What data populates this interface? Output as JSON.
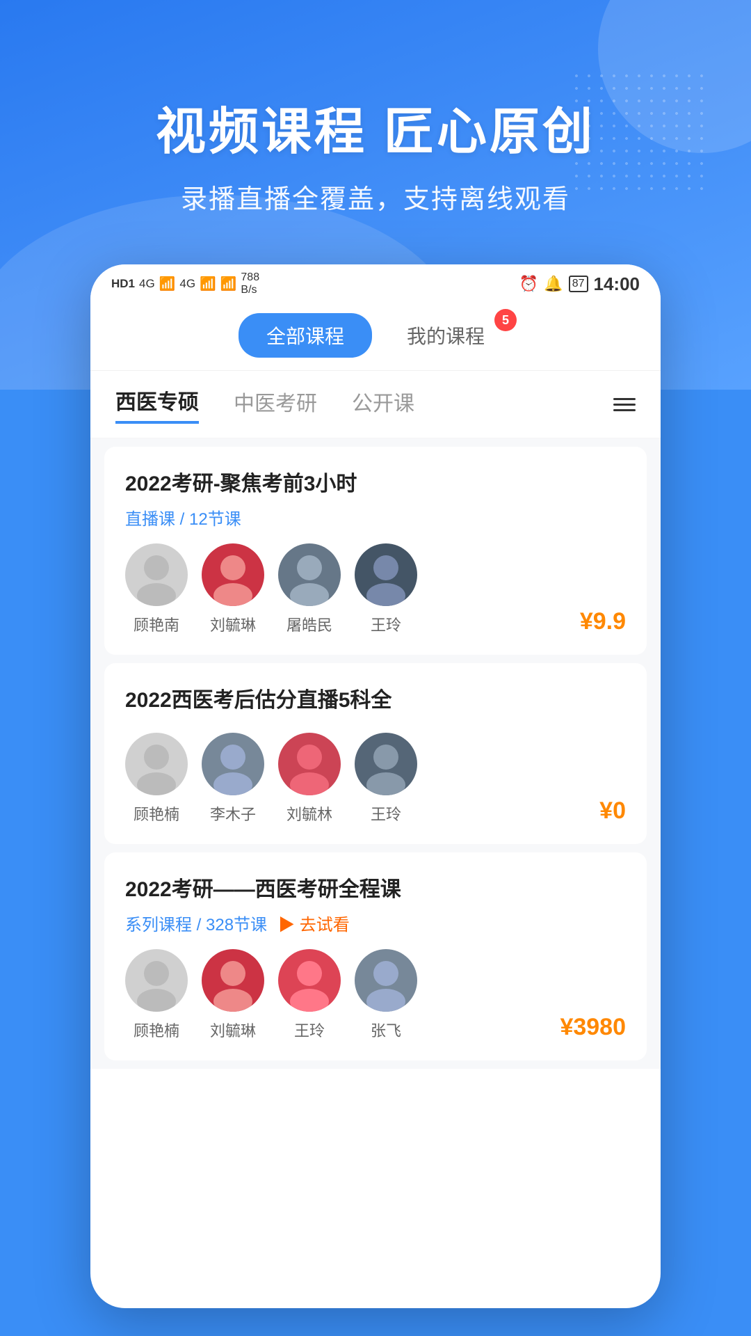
{
  "hero": {
    "title": "视频课程 匠心原创",
    "subtitle": "录播直播全覆盖，支持离线观看"
  },
  "status_bar": {
    "left": "HD1 4G 4G 788 B/s",
    "right": "14:00",
    "battery": "87"
  },
  "tabs": {
    "all_courses": "全部课程",
    "my_courses": "我的课程",
    "badge": "5"
  },
  "categories": [
    {
      "id": "western",
      "label": "西医专硕",
      "active": true
    },
    {
      "id": "tcm",
      "label": "中医考研",
      "active": false
    },
    {
      "id": "open",
      "label": "公开课",
      "active": false
    }
  ],
  "courses": [
    {
      "id": 1,
      "title": "2022考研-聚焦考前3小时",
      "meta_type": "直播课",
      "meta_lessons": "12节课",
      "teachers": [
        {
          "name": "顾艳南",
          "avatar_color": "#c8c8c8"
        },
        {
          "name": "刘毓琳",
          "avatar_color": "#bb3344"
        },
        {
          "name": "屠皓民",
          "avatar_color": "#667788"
        },
        {
          "name": "王玲",
          "avatar_color": "#445566"
        }
      ],
      "price": "¥9.9",
      "price_color": "#ff8800",
      "show_try": false
    },
    {
      "id": 2,
      "title": "2022西医考后估分直播5科全",
      "meta_type": "",
      "meta_lessons": "",
      "teachers": [
        {
          "name": "顾艳楠",
          "avatar_color": "#c8c8c8"
        },
        {
          "name": "李木子",
          "avatar_color": "#778899"
        },
        {
          "name": "刘毓林",
          "avatar_color": "#cc5566"
        },
        {
          "name": "王玲",
          "avatar_color": "#556677"
        }
      ],
      "price": "¥0",
      "price_color": "#ff8800",
      "show_try": false
    },
    {
      "id": 3,
      "title": "2022考研——西医考研全程课",
      "meta_type": "系列课程",
      "meta_lessons": "328节课",
      "teachers": [
        {
          "name": "顾艳楠",
          "avatar_color": "#c8c8c8"
        },
        {
          "name": "刘毓琳",
          "avatar_color": "#bb3344"
        },
        {
          "name": "王玲",
          "avatar_color": "#dd5566"
        },
        {
          "name": "张飞",
          "avatar_color": "#778899"
        }
      ],
      "price": "¥3980",
      "price_color": "#ff8800",
      "show_try": true,
      "try_label": "▶ 去试看"
    }
  ]
}
